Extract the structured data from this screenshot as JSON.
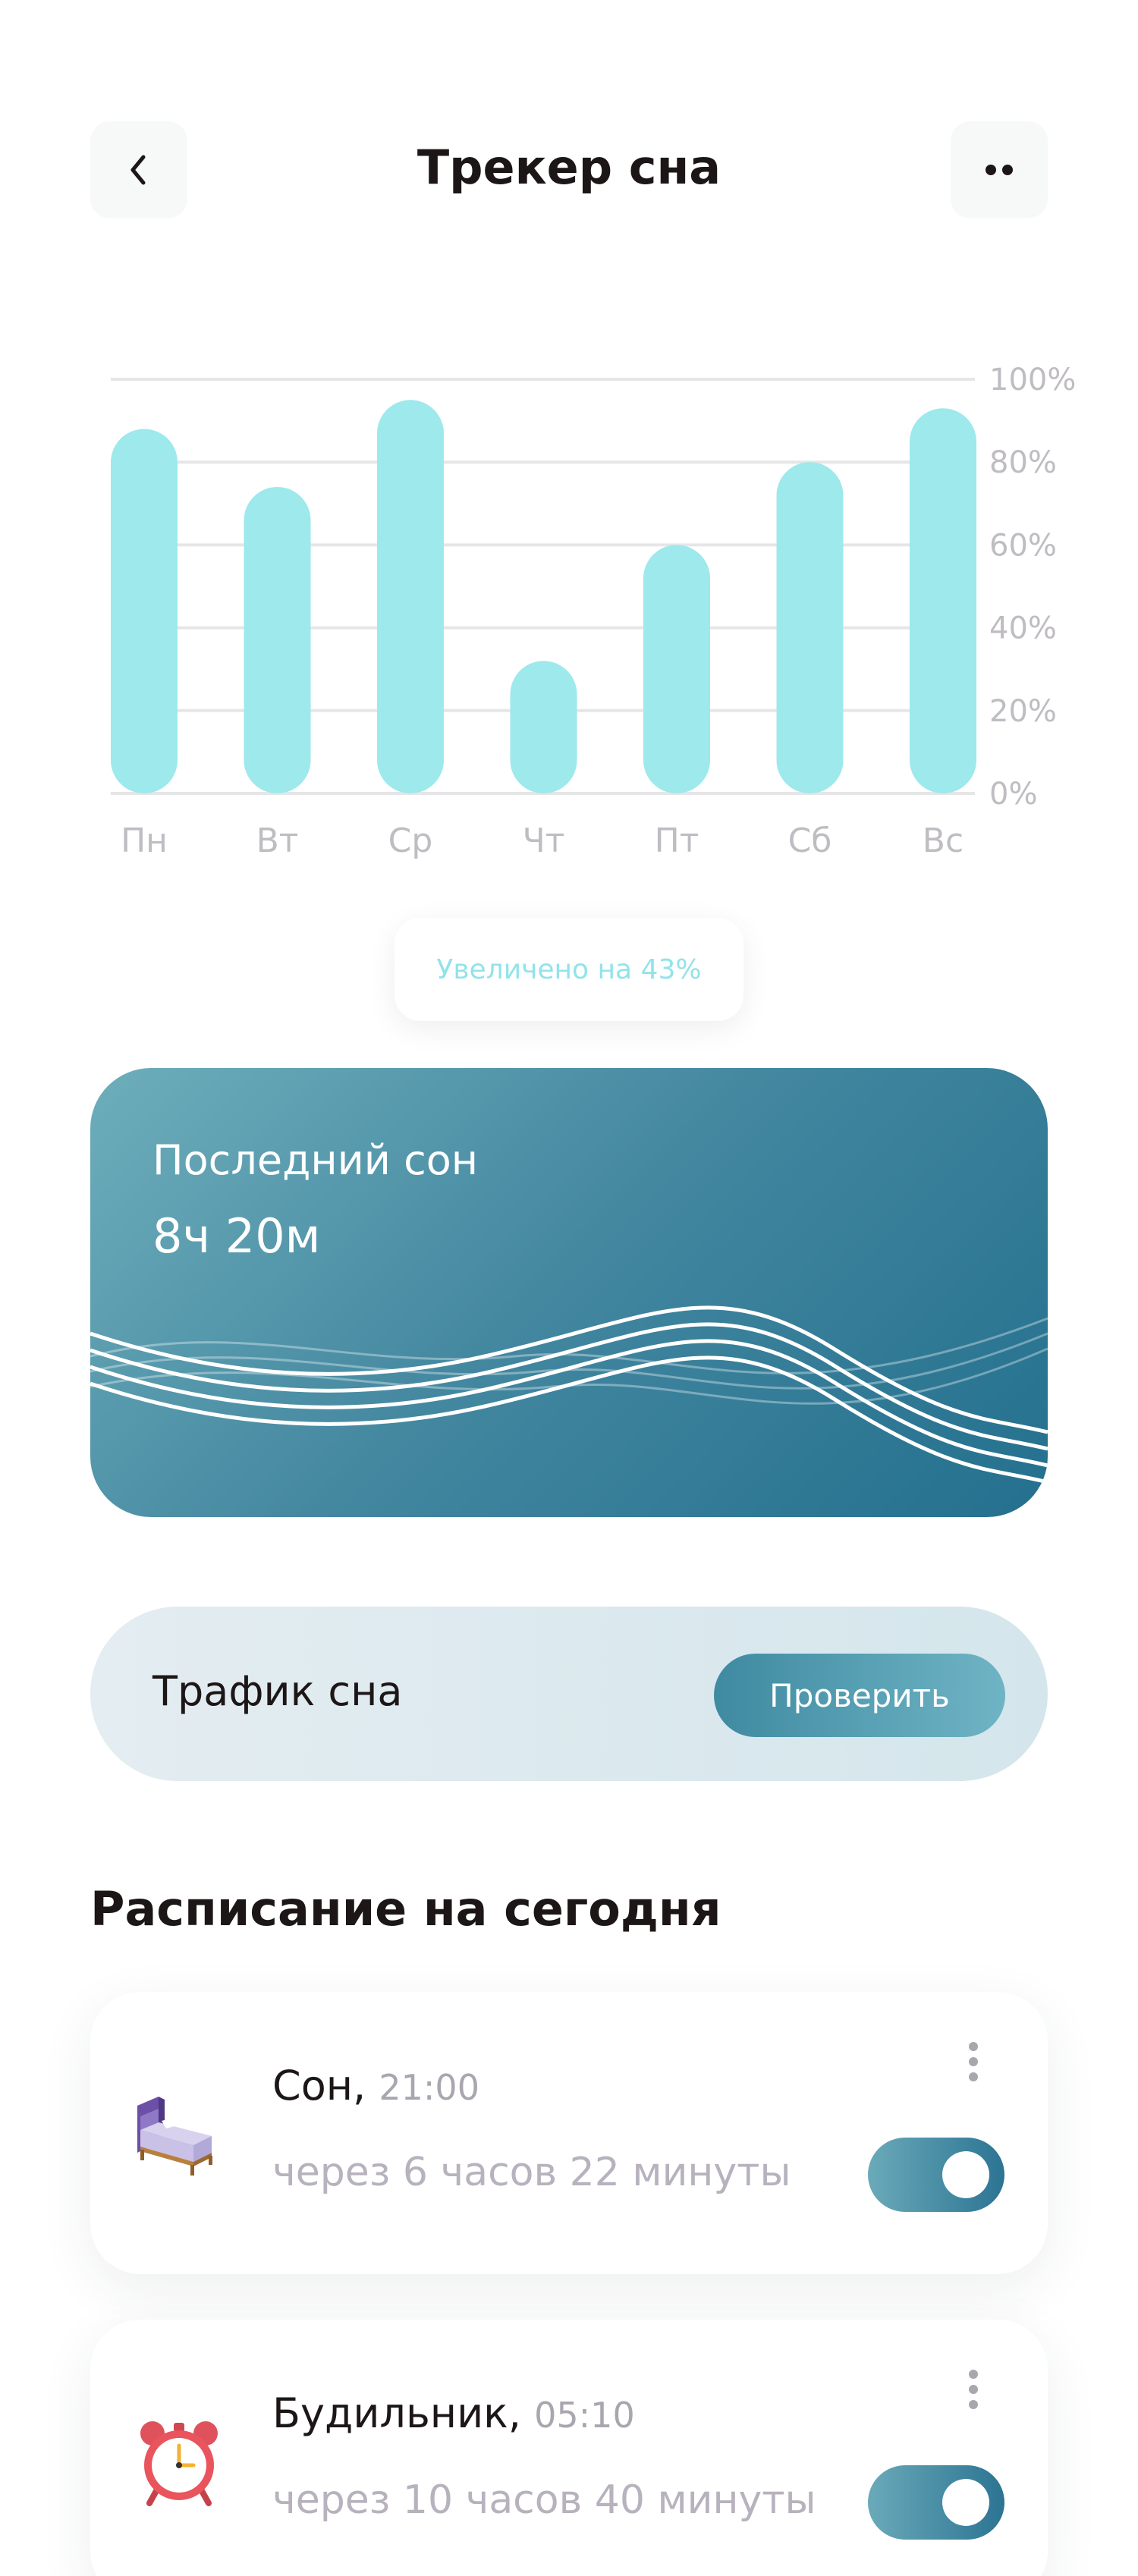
{
  "header": {
    "title": "Трекер сна",
    "back_icon": "chevron-left-icon",
    "more_icon": "more-dots-icon"
  },
  "chart_data": {
    "type": "bar",
    "categories": [
      "Пн",
      "Вт",
      "Ср",
      "Чт",
      "Пт",
      "Сб",
      "Вс"
    ],
    "values": [
      88,
      74,
      95,
      32,
      60,
      80,
      93
    ],
    "ylim": [
      0,
      100
    ],
    "yticks": [
      "0%",
      "20%",
      "40%",
      "60%",
      "80%",
      "100%"
    ],
    "grid": true,
    "bar_color": "#9de9ec"
  },
  "summary": {
    "badge": "Увеличено на 43%"
  },
  "last_sleep": {
    "title": "Последний сон",
    "value": "8ч 20м"
  },
  "traffic": {
    "label": "Трафик сна",
    "button": "Проверить"
  },
  "schedule": {
    "title": "Расписание на сегодня",
    "items": [
      {
        "name": "Сон,",
        "time": "21:00",
        "subtitle": "через 6 часов 22 минуты",
        "icon": "bed-icon",
        "enabled": true
      },
      {
        "name": "Будильник,",
        "time": "05:10",
        "subtitle": "через 10 часов 40 минуты",
        "icon": "alarm-clock-icon",
        "enabled": true
      }
    ]
  },
  "colors": {
    "accent": "#2c7493",
    "bar": "#9de9ec",
    "text": "#1d1617"
  }
}
